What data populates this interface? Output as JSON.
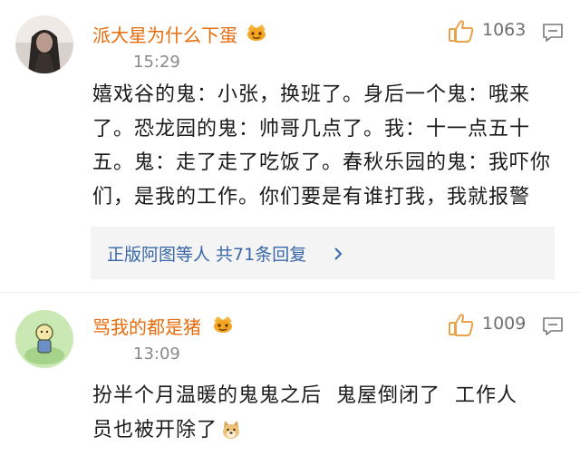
{
  "comments": [
    {
      "username": "派大星为什么下蛋",
      "time": "15:29",
      "likes": "1063",
      "avatar_icon": "dark-portrait-avatar",
      "content_lines": [
        "嬉戏谷的鬼：小张，换班了。身后一个鬼：哦来",
        "了。恐龙园的鬼：帅哥几点了。我：十一点五十",
        "五。鬼：走了走了吃饭了。春秋乐园的鬼：我吓你",
        "们，是我的工作。你们要是有谁打我，我就报警"
      ],
      "sub_replies": "正版阿图等人 共71条回复"
    },
    {
      "username": "骂我的都是猪",
      "time": "13:09",
      "likes": "1009",
      "avatar_icon": "cartoon-figure-avatar",
      "content_lines": [
        "扮半个月温暖的鬼鬼之后  鬼屋倒闭了  工作人",
        "员也被开除了"
      ]
    }
  ],
  "colors": {
    "username": "#e86c0c",
    "link": "#3a67a8",
    "meta": "#8a8a8a",
    "like_icon": "#e8a24a"
  }
}
